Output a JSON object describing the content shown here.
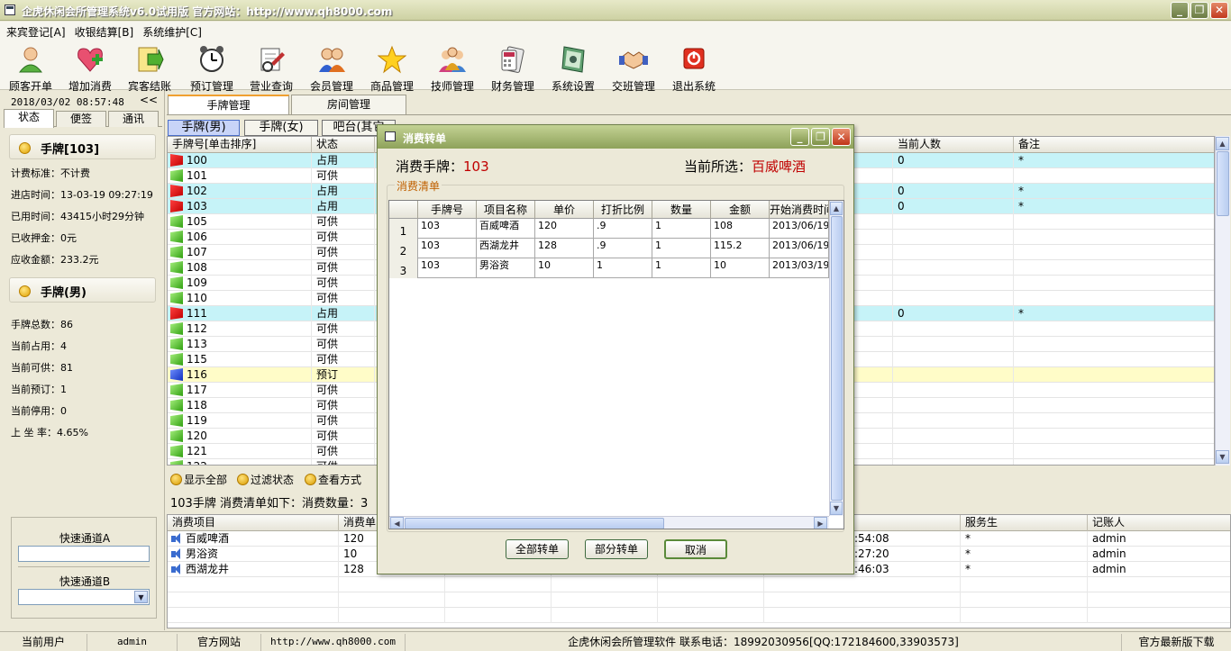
{
  "window": {
    "title": "企虎休闲会所管理系统v6.0试用版   官方网站：http://www.qh8000.com",
    "minimize": "_",
    "restore": "❐",
    "close": "✕"
  },
  "menu": [
    "来宾登记[A]",
    "收银结算[B]",
    "系统维护[C]"
  ],
  "toolbar": [
    {
      "label": "顾客开单",
      "icon": "customer-icon"
    },
    {
      "label": "增加消费",
      "icon": "add-consume-icon"
    },
    {
      "label": "宾客结账",
      "icon": "checkout-icon"
    },
    {
      "label": "预订管理",
      "icon": "alarm-clock-icon"
    },
    {
      "label": "营业查询",
      "icon": "query-icon"
    },
    {
      "label": "会员管理",
      "icon": "members-icon"
    },
    {
      "label": "商品管理",
      "icon": "star-icon"
    },
    {
      "label": "技师管理",
      "icon": "technician-icon"
    },
    {
      "label": "财务管理",
      "icon": "finance-icon"
    },
    {
      "label": "系统设置",
      "icon": "settings-icon"
    },
    {
      "label": "交班管理",
      "icon": "handshake-icon"
    },
    {
      "label": "退出系统",
      "icon": "power-icon"
    }
  ],
  "left": {
    "datetime": "2018/03/02 08:57:48",
    "collapse": "<<",
    "tabs": [
      "状态",
      "便签",
      "通讯"
    ],
    "section1": "手牌[103]",
    "info1": [
      "计费标准：不计费",
      "进店时间：13-03-19 09:27:19",
      "已用时间：43415小时29分钟",
      "已收押金：0元",
      "应收金额：233.2元"
    ],
    "section2": "手牌(男)",
    "info2": [
      "手牌总数：86",
      "当前占用：4",
      "当前可供：81",
      "当前预订：1",
      "当前停用：0",
      "上 坐 率：4.65%"
    ],
    "quickA": "快速通道A",
    "quickB": "快速通道B"
  },
  "page_tabs": [
    "手牌管理",
    "房间管理"
  ],
  "sub_tabs": [
    "手牌(男)",
    "手牌(女)",
    "吧台(其它"
  ],
  "grid": {
    "headers": [
      "手牌号[单击排序]",
      "状态",
      "当前人数",
      "备注"
    ],
    "rows": [
      {
        "no": "100",
        "status": "占用",
        "flag": "r",
        "people": "0",
        "note": "*"
      },
      {
        "no": "101",
        "status": "可供",
        "flag": "g",
        "people": "",
        "note": ""
      },
      {
        "no": "102",
        "status": "占用",
        "flag": "r",
        "people": "0",
        "note": "*"
      },
      {
        "no": "103",
        "status": "占用",
        "flag": "r",
        "people": "0",
        "note": "*"
      },
      {
        "no": "105",
        "status": "可供",
        "flag": "g",
        "people": "",
        "note": ""
      },
      {
        "no": "106",
        "status": "可供",
        "flag": "g",
        "people": "",
        "note": ""
      },
      {
        "no": "107",
        "status": "可供",
        "flag": "g",
        "people": "",
        "note": ""
      },
      {
        "no": "108",
        "status": "可供",
        "flag": "g",
        "people": "",
        "note": ""
      },
      {
        "no": "109",
        "status": "可供",
        "flag": "g",
        "people": "",
        "note": ""
      },
      {
        "no": "110",
        "status": "可供",
        "flag": "g",
        "people": "",
        "note": ""
      },
      {
        "no": "111",
        "status": "占用",
        "flag": "r",
        "people": "0",
        "note": "*"
      },
      {
        "no": "112",
        "status": "可供",
        "flag": "g",
        "people": "",
        "note": ""
      },
      {
        "no": "113",
        "status": "可供",
        "flag": "g",
        "people": "",
        "note": ""
      },
      {
        "no": "115",
        "status": "可供",
        "flag": "g",
        "people": "",
        "note": ""
      },
      {
        "no": "116",
        "status": "预订",
        "flag": "b",
        "people": "",
        "note": ""
      },
      {
        "no": "117",
        "status": "可供",
        "flag": "g",
        "people": "",
        "note": ""
      },
      {
        "no": "118",
        "status": "可供",
        "flag": "g",
        "people": "",
        "note": ""
      },
      {
        "no": "119",
        "status": "可供",
        "flag": "g",
        "people": "",
        "note": ""
      },
      {
        "no": "120",
        "status": "可供",
        "flag": "g",
        "people": "",
        "note": ""
      },
      {
        "no": "121",
        "status": "可供",
        "flag": "g",
        "people": "",
        "note": ""
      },
      {
        "no": "122",
        "status": "可供",
        "flag": "g",
        "people": "",
        "note": ""
      }
    ]
  },
  "filters": [
    "显示全部",
    "过滤状态",
    "查看方式"
  ],
  "consume_info": "103手牌   消费清单如下：消费数量：3",
  "grid2": {
    "headers": [
      "消费项目",
      "消费单",
      "服务生",
      "记账人"
    ],
    "rows": [
      {
        "item": "百威啤酒",
        "qty": "120",
        "time": ":54:08",
        "waiter": "*",
        "clerk": "admin"
      },
      {
        "item": "男浴资",
        "qty": "10",
        "time": ":27:20",
        "waiter": "*",
        "clerk": "admin"
      },
      {
        "item": "西湖龙井",
        "qty": "128",
        "time": ":46:03",
        "waiter": "*",
        "clerk": "admin"
      }
    ]
  },
  "dialog": {
    "title": "消费转单",
    "card_label": "消费手牌：",
    "card_value": "103",
    "selected_label": "当前所选：",
    "selected_value": "百威啤酒",
    "legend": "消费清单",
    "headers": [
      "手牌号",
      "项目名称",
      "单价",
      "打折比例",
      "数量",
      "金额",
      "开始消费时间"
    ],
    "rows": [
      {
        "n": "1",
        "card": "103",
        "name": "百威啤酒",
        "price": "120",
        "disc": ".9",
        "qty": "1",
        "amt": "108",
        "start": "2013/06/19"
      },
      {
        "n": "2",
        "card": "103",
        "name": "西湖龙井",
        "price": "128",
        "disc": ".9",
        "qty": "1",
        "amt": "115.2",
        "start": "2013/06/19"
      },
      {
        "n": "3",
        "card": "103",
        "name": "男浴资",
        "price": "10",
        "disc": "1",
        "qty": "1",
        "amt": "10",
        "start": "2013/03/19"
      }
    ],
    "buttons": [
      "全部转单",
      "部分转单",
      "取消"
    ]
  },
  "status": {
    "user_label": "当前用户",
    "user": "admin",
    "site_label": "官方网站",
    "site": "http://www.qh8000.com",
    "company": "企虎休闲会所管理软件   联系电话：18992030956[QQ:172184600,33903573]",
    "download": "官方最新版下载"
  }
}
